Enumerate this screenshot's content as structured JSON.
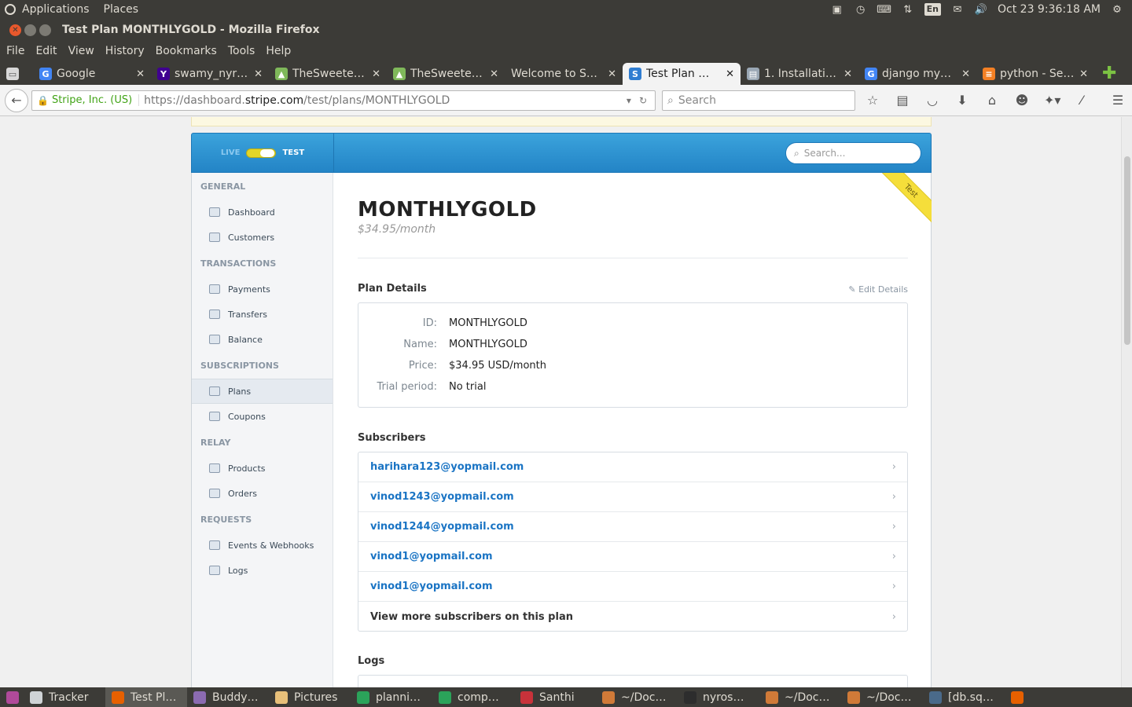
{
  "top_panel": {
    "menus": [
      "Applications",
      "Places"
    ],
    "keyboard_layout": "En",
    "clock": "Oct 23  9:36:18 AM"
  },
  "window": {
    "title": "Test Plan MONTHLYGOLD - Mozilla Firefox"
  },
  "menubar": [
    "File",
    "Edit",
    "View",
    "History",
    "Bookmarks",
    "Tools",
    "Help"
  ],
  "tabs": [
    {
      "label": "Google",
      "favicon": "google-icon",
      "color": "#4285f4",
      "glyph": "G"
    },
    {
      "label": "swamy_nyr…",
      "favicon": "yahoo-icon",
      "color": "#400090",
      "glyph": "Y"
    },
    {
      "label": "TheSweete…",
      "favicon": "leaf-icon",
      "color": "#7fb85a",
      "glyph": "▲"
    },
    {
      "label": "TheSweete…",
      "favicon": "leaf-icon",
      "color": "#7fb85a",
      "glyph": "▲"
    },
    {
      "label": "Welcome to S…",
      "favicon": "",
      "color": "",
      "glyph": ""
    },
    {
      "label": "Test Plan …",
      "favicon": "stripe-icon",
      "color": "#2f7dd1",
      "glyph": "S",
      "active": true
    },
    {
      "label": "1. Installati…",
      "favicon": "doc-icon",
      "color": "#9aa7b4",
      "glyph": "▤"
    },
    {
      "label": "django my…",
      "favicon": "google-icon",
      "color": "#4285f4",
      "glyph": "G"
    },
    {
      "label": "python - Se…",
      "favicon": "stackoverflow-icon",
      "color": "#f48024",
      "glyph": "≡"
    }
  ],
  "navbar": {
    "site_identity": "Stripe, Inc. (US)",
    "url_prefix": "https://dashboard.",
    "url_domain": "stripe.com",
    "url_path": "/test/plans/MONTHLYGOLD",
    "search_placeholder": "Search"
  },
  "dashboard": {
    "mode_live": "LIVE",
    "mode_test": "TEST",
    "search_placeholder": "Search...",
    "ribbon": "Test"
  },
  "sidebar": {
    "sections": [
      {
        "title": "GENERAL",
        "items": [
          {
            "label": "Dashboard"
          },
          {
            "label": "Customers"
          }
        ]
      },
      {
        "title": "TRANSACTIONS",
        "items": [
          {
            "label": "Payments"
          },
          {
            "label": "Transfers"
          },
          {
            "label": "Balance"
          }
        ]
      },
      {
        "title": "SUBSCRIPTIONS",
        "items": [
          {
            "label": "Plans",
            "active": true
          },
          {
            "label": "Coupons"
          }
        ]
      },
      {
        "title": "RELAY",
        "items": [
          {
            "label": "Products"
          },
          {
            "label": "Orders"
          }
        ]
      },
      {
        "title": "REQUESTS",
        "items": [
          {
            "label": "Events & Webhooks"
          },
          {
            "label": "Logs"
          }
        ]
      }
    ]
  },
  "plan": {
    "name": "MONTHLYGOLD",
    "price_summary": "$34.95/month",
    "details_title": "Plan Details",
    "edit_label": "Edit Details",
    "details": [
      {
        "key": "ID:",
        "value": "MONTHLYGOLD"
      },
      {
        "key": "Name:",
        "value": "MONTHLYGOLD"
      },
      {
        "key": "Price:",
        "value": "$34.95 USD/month"
      },
      {
        "key": "Trial period:",
        "value": "No trial"
      }
    ],
    "subscribers_title": "Subscribers",
    "subscribers": [
      "harihara123@yopmail.com",
      "vinod1243@yopmail.com",
      "vinod1244@yopmail.com",
      "vinod1@yopmail.com",
      "vinod1@yopmail.com"
    ],
    "view_more": "View more subscribers on this plan",
    "logs_title": "Logs"
  },
  "taskbar": [
    {
      "label": "Tracker",
      "color": "#cfd3d6"
    },
    {
      "label": "Test Pl…",
      "color": "#e66000",
      "active": true
    },
    {
      "label": "Buddy…",
      "color": "#8b6bb1"
    },
    {
      "label": "Pictures",
      "color": "#e8c07a"
    },
    {
      "label": "planni…",
      "color": "#2ba35a"
    },
    {
      "label": "comp…",
      "color": "#2ba35a"
    },
    {
      "label": "Santhi",
      "color": "#c8323a"
    },
    {
      "label": "~/Doc…",
      "color": "#d07a38"
    },
    {
      "label": "nyros…",
      "color": "#2d2d2d"
    },
    {
      "label": "~/Doc…",
      "color": "#d07a38"
    },
    {
      "label": "~/Doc…",
      "color": "#d07a38"
    },
    {
      "label": "[db.sq…",
      "color": "#4a6a8a"
    },
    {
      "label": "",
      "color": "#e66000"
    }
  ]
}
